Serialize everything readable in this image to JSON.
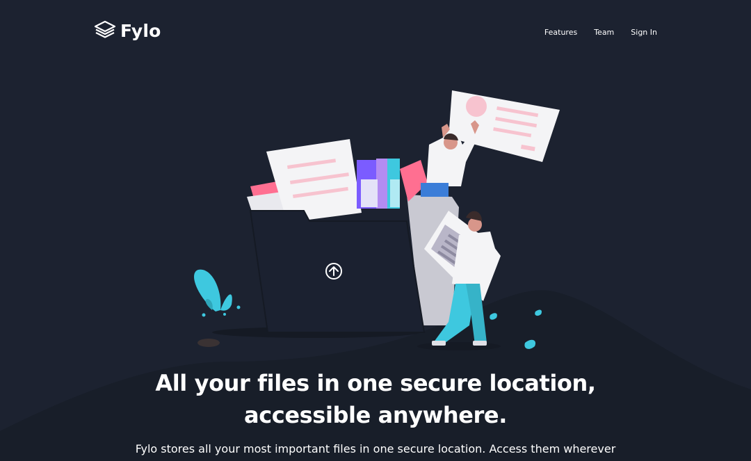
{
  "brand": {
    "name": "Fylo",
    "logo_icon": "stacked-layers-icon"
  },
  "nav": {
    "items": [
      "Features",
      "Team",
      "Sign In"
    ]
  },
  "hero": {
    "title": "All your files in one secure location, accessible anywhere.",
    "subtitle": "Fylo stores all your most important files in one secure location. Access them wherever you need, share and collaborate with friends family, and co-workers.",
    "upload_icon": "upload-arrow-icon"
  },
  "colors": {
    "background": "#1c2230",
    "curve": "#181e29",
    "accent_cyan": "#3ec8df",
    "accent_pink": "#ff6f91"
  }
}
